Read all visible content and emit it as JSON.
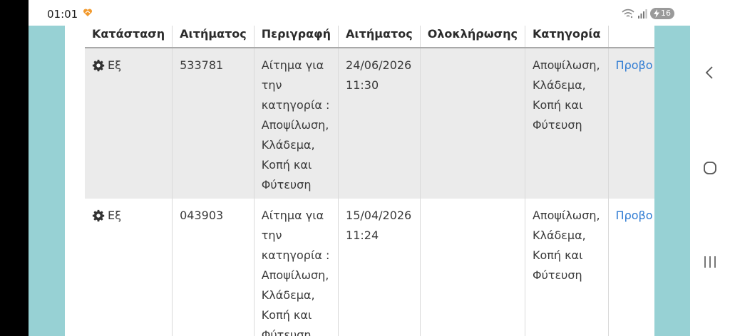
{
  "status_bar": {
    "time": "01:01",
    "battery_level": "16",
    "notification_icon": "heart-notification-icon",
    "wifi_icon": "wifi-icon",
    "signal_icon": "signal-icon"
  },
  "table": {
    "headers": [
      "Κατάσταση",
      "Αιτήματος",
      "Περιγραφή",
      "Αιτήματος",
      "Ολοκλήρωσης",
      "Κατηγορία",
      ""
    ],
    "rows": [
      {
        "status": "Εξ",
        "id": "533781",
        "description": "Αίτημα για την κατηγορία : Αποψίλωση, Κλάδεμα, Κοπή και Φύτευση",
        "date": "24/06/2026 11:30",
        "completion": "",
        "category": "Αποψίλωση, Κλάδεμα, Κοπή και Φύτευση",
        "action": "Προβο"
      },
      {
        "status": "Εξ",
        "id": "043903",
        "description": "Αίτημα για την κατηγορία : Αποψίλωση, Κλάδεμα, Κοπή και Φύτευση",
        "date": "15/04/2026 11:24",
        "completion": "",
        "category": "Αποψίλωση, Κλάδεμα, Κοπή και Φύτευση",
        "action": "Προβο"
      }
    ]
  },
  "colors": {
    "side_background": "#97d1d4",
    "row_highlight": "#ebebeb",
    "link": "#2e7bd3"
  },
  "nav": {
    "back_icon": "back-chevron-icon",
    "home_icon": "home-icon",
    "recents_icon": "recents-icon"
  }
}
